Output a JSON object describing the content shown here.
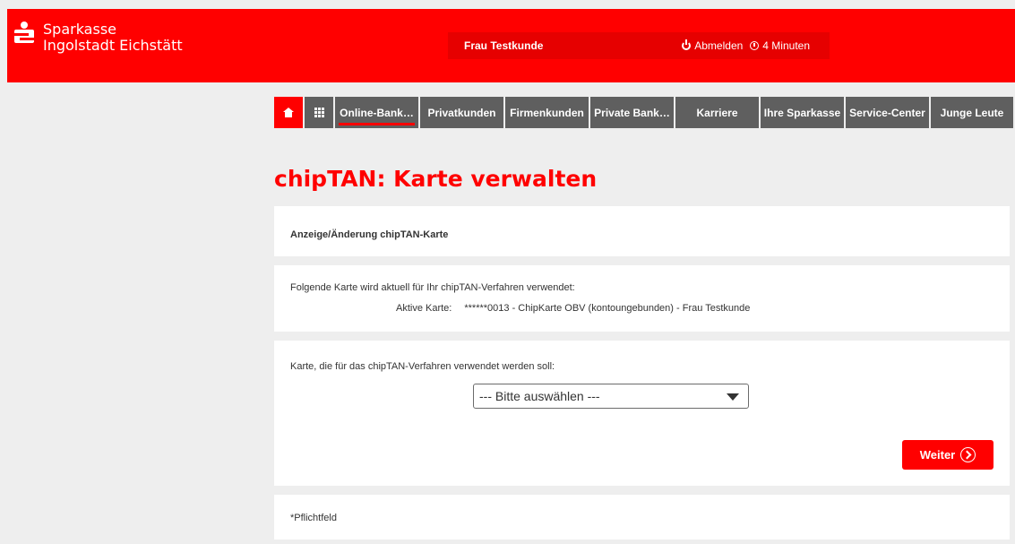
{
  "brand": {
    "line1": "Sparkasse",
    "line2": "Ingolstadt Eichstätt"
  },
  "userbar": {
    "user": "Frau Testkunde",
    "logout": "Abmelden",
    "timer": "4 Minuten"
  },
  "nav": {
    "items": [
      {
        "label": "Online-Bank…",
        "active": true
      },
      {
        "label": "Privatkunden"
      },
      {
        "label": "Firmenkunden"
      },
      {
        "label": "Private Bank…"
      },
      {
        "label": "Karriere"
      },
      {
        "label": "Ihre Sparkasse"
      },
      {
        "label": "Service-Center"
      },
      {
        "label": "Junge Leute"
      }
    ]
  },
  "page": {
    "title": "chipTAN: Karte verwalten"
  },
  "panel1": {
    "heading": "Anzeige/Änderung chipTAN-Karte"
  },
  "panel2": {
    "intro": "Folgende Karte wird aktuell für Ihr chipTAN-Verfahren verwendet:",
    "active_label": "Aktive Karte:",
    "active_value": "******0013 - ChipKarte OBV (kontoungebunden) - Frau Testkunde"
  },
  "panel3": {
    "label": "Karte, die für das chipTAN-Verfahren verwendet werden soll:",
    "select_value": "--- Bitte auswählen ---",
    "button": "Weiter"
  },
  "panel4": {
    "note": "*Pflichtfeld"
  },
  "colors": {
    "brand_red": "#ff0000",
    "nav_gray": "#5f5f5f"
  }
}
